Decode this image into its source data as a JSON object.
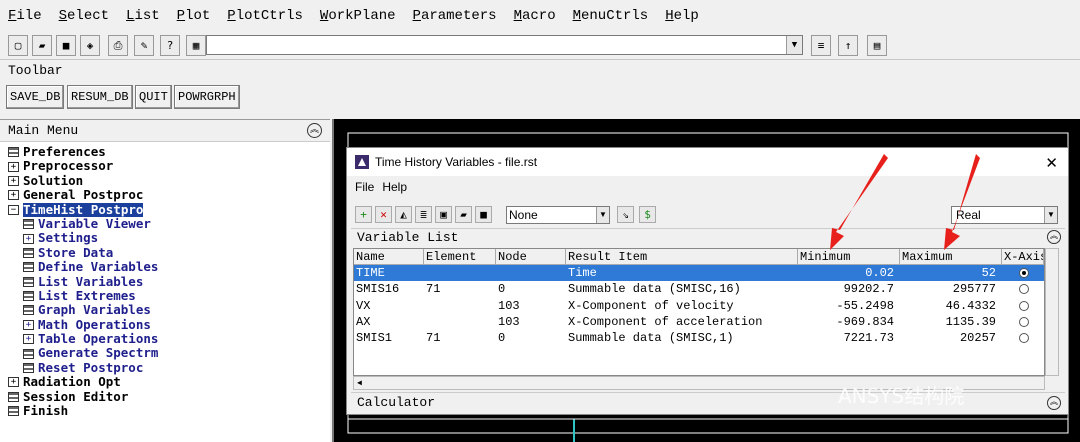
{
  "menubar": [
    "File",
    "Select",
    "List",
    "Plot",
    "PlotCtrls",
    "WorkPlane",
    "Parameters",
    "Macro",
    "MenuCtrls",
    "Help"
  ],
  "toolbar_label": "Toolbar",
  "quick_buttons": [
    "SAVE_DB",
    "RESUM_DB",
    "QUIT",
    "POWRGRPH"
  ],
  "main_menu": {
    "title": "Main Menu",
    "items": [
      {
        "label": "Preferences",
        "icon": "doc"
      },
      {
        "label": "Preprocessor",
        "icon": "plus"
      },
      {
        "label": "Solution",
        "icon": "plus"
      },
      {
        "label": "General Postproc",
        "icon": "plus"
      },
      {
        "label": "TimeHist Postpro",
        "icon": "minus",
        "selected": true
      },
      {
        "label": "Variable Viewer",
        "icon": "doc",
        "sub": true
      },
      {
        "label": "Settings",
        "icon": "plus",
        "sub": true
      },
      {
        "label": "Store Data",
        "icon": "doc",
        "sub": true
      },
      {
        "label": "Define Variables",
        "icon": "doc",
        "sub": true
      },
      {
        "label": "List Variables",
        "icon": "doc",
        "sub": true
      },
      {
        "label": "List Extremes",
        "icon": "doc",
        "sub": true
      },
      {
        "label": "Graph Variables",
        "icon": "doc",
        "sub": true
      },
      {
        "label": "Math Operations",
        "icon": "plus",
        "sub": true
      },
      {
        "label": "Table Operations",
        "icon": "plus",
        "sub": true
      },
      {
        "label": "Generate Spectrm",
        "icon": "doc",
        "sub": true
      },
      {
        "label": "Reset Postproc",
        "icon": "doc",
        "sub": true
      },
      {
        "label": "Radiation Opt",
        "icon": "plus"
      },
      {
        "label": "Session Editor",
        "icon": "doc"
      },
      {
        "label": "Finish",
        "icon": "doc"
      }
    ]
  },
  "dialog": {
    "title": "Time History Variables - file.rst",
    "menu": [
      "File",
      "Help"
    ],
    "result_select": "None",
    "type_select": "Real",
    "variable_list": "Variable List",
    "calculator": "Calculator",
    "columns": [
      "Name",
      "Element",
      "Node",
      "Result Item",
      "Minimum",
      "Maximum",
      "X-Axis"
    ],
    "rows": [
      {
        "name": "TIME",
        "element": "",
        "node": "",
        "item": "Time",
        "min": "0.02",
        "max": "52",
        "xaxis": true
      },
      {
        "name": "SMIS16",
        "element": "71",
        "node": "0",
        "item": "Summable data (SMISC,16)",
        "min": "99202.7",
        "max": "295777",
        "xaxis": false
      },
      {
        "name": "VX",
        "element": "",
        "node": "103",
        "item": "X-Component of velocity",
        "min": "-55.2498",
        "max": "46.4332",
        "xaxis": false
      },
      {
        "name": "AX",
        "element": "",
        "node": "103",
        "item": "X-Component of acceleration",
        "min": "-969.834",
        "max": "1135.39",
        "xaxis": false
      },
      {
        "name": "SMIS1",
        "element": "71",
        "node": "0",
        "item": "Summable data (SMISC,1)",
        "min": "7221.73",
        "max": "20257",
        "xaxis": false
      }
    ]
  },
  "watermark": "ANSYS结构院",
  "colors": {
    "selection": "#1a3f9c",
    "row_highlight": "#2f7ad6",
    "arrow": "#e8201c"
  }
}
